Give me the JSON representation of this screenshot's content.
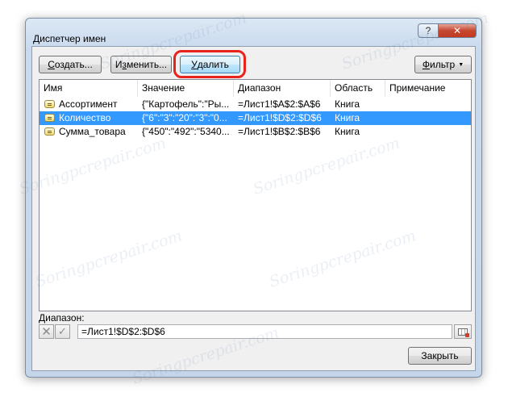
{
  "window": {
    "title": "Диспетчер имен",
    "help_label": "?",
    "close_label": "✕"
  },
  "toolbar": {
    "create_label": "Создать...",
    "create_mnemonic": "С",
    "create_rest": "оздать...",
    "edit_label": "Изменить...",
    "edit_pre": "И",
    "edit_mnemonic": "з",
    "edit_rest": "менить...",
    "delete_label": "Удалить",
    "delete_mnemonic": "У",
    "delete_rest": "далить",
    "filter_label": "Фильтр",
    "filter_mnemonic": "Ф",
    "filter_rest": "ильтр"
  },
  "list": {
    "columns": [
      "Имя",
      "Значение",
      "Диапазон",
      "Область",
      "Примечание"
    ],
    "rows": [
      {
        "name": "Ассортимент",
        "value": "{\"Картофель\":\"Ры...",
        "range": "=Лист1!$A$2:$A$6",
        "scope": "Книга",
        "note": "",
        "selected": false
      },
      {
        "name": "Количество",
        "value": "{\"6\":\"3\":\"20\":\"3\":\"0...",
        "range": "=Лист1!$D$2:$D$6",
        "scope": "Книга",
        "note": "",
        "selected": true
      },
      {
        "name": "Сумма_товара",
        "value": "{\"450\":\"492\":\"5340...",
        "range": "=Лист1!$B$2:$B$6",
        "scope": "Книга",
        "note": "",
        "selected": false
      }
    ]
  },
  "range_field": {
    "label": "Диапазон:",
    "value": "=Лист1!$D$2:$D$6",
    "cancel_icon": "cancel-x-icon",
    "ok_icon": "checkmark-icon",
    "collapse_icon": "range-collapse-icon"
  },
  "footer": {
    "close_label": "Закрыть"
  },
  "watermark": "Soringpcrepair.com",
  "colors": {
    "selection": "#3399ff",
    "highlight_ring": "#e8221c",
    "close_button": "#c8462d"
  }
}
